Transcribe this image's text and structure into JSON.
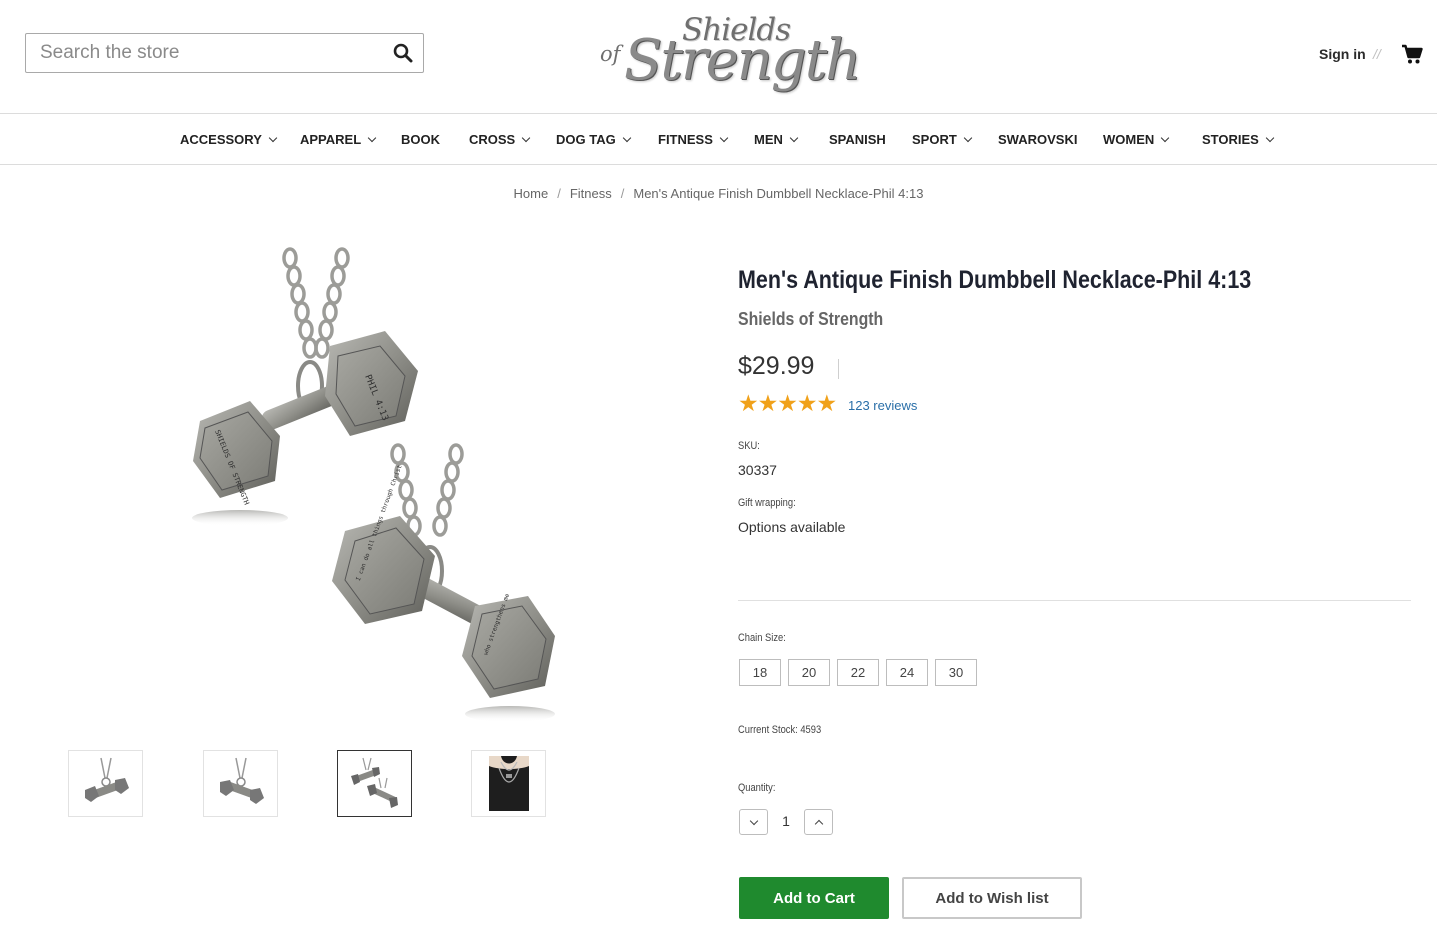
{
  "header": {
    "search_placeholder": "Search the store",
    "logo_line1": "Shields",
    "logo_of": "of",
    "logo_line2": "Strength",
    "signin_label": "Sign in",
    "separator": "//"
  },
  "nav": {
    "items": [
      {
        "label": "ACCESSORY",
        "dropdown": true
      },
      {
        "label": "APPAREL",
        "dropdown": true
      },
      {
        "label": "BOOK",
        "dropdown": false
      },
      {
        "label": "CROSS",
        "dropdown": true
      },
      {
        "label": "DOG TAG",
        "dropdown": true
      },
      {
        "label": "FITNESS",
        "dropdown": true
      },
      {
        "label": "MEN",
        "dropdown": true
      },
      {
        "label": "SPANISH",
        "dropdown": false
      },
      {
        "label": "SPORT",
        "dropdown": true
      },
      {
        "label": "SWAROVSKI",
        "dropdown": false
      },
      {
        "label": "WOMEN",
        "dropdown": true
      },
      {
        "label": "STORIES",
        "dropdown": true
      }
    ]
  },
  "breadcrumb": {
    "items": [
      "Home",
      "Fitness",
      "Men's Antique Finish Dumbbell Necklace-Phil 4:13"
    ],
    "separator": "/"
  },
  "product": {
    "title": "Men's Antique Finish Dumbbell Necklace-Phil 4:13",
    "brand": "Shields of Strength",
    "price": "$29.99",
    "rating_stars": "★★★★★",
    "rating_value": 5,
    "reviews_label": "123 reviews",
    "sku_label": "SKU:",
    "sku_value": "30337",
    "gift_label": "Gift wrapping:",
    "gift_value": "Options available",
    "chain_size_label": "Chain Size:",
    "chain_sizes": [
      "18",
      "20",
      "22",
      "24",
      "30"
    ],
    "stock_label": "Current Stock: 4593",
    "quantity_label": "Quantity:",
    "quantity_value": "1",
    "add_to_cart_label": "Add to Cart",
    "add_to_wishlist_label": "Add to Wish list",
    "pendant_text_1": "PHIL 4:13",
    "pendant_text_2": "SHIELDS OF STRENGTH",
    "pendant_text_3": "I can do all things through Christ",
    "pendant_text_4": "who strengthens me"
  },
  "colors": {
    "cart_button": "#1f8a2e",
    "link": "#2a6fa8",
    "star": "#f0a11a",
    "title": "#1f2330"
  },
  "icons": [
    "search-icon",
    "cart-icon",
    "chevron-down-icon",
    "chevron-up-icon"
  ]
}
